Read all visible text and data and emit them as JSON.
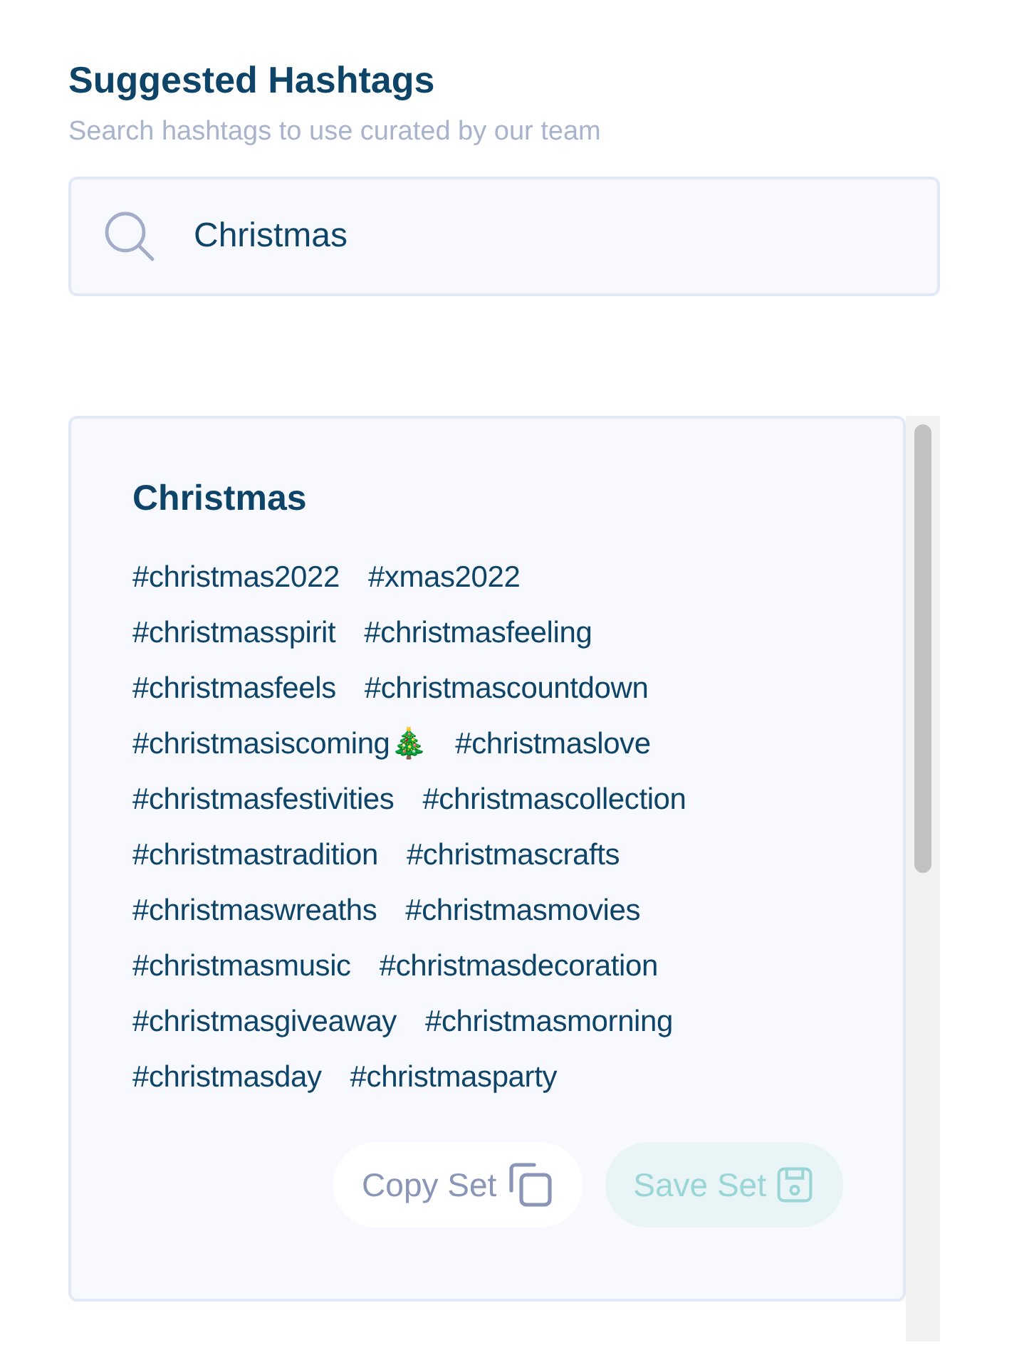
{
  "header": {
    "title": "Suggested Hashtags",
    "subtitle": "Search hashtags to use curated by our team"
  },
  "search": {
    "value": "Christmas"
  },
  "card": {
    "title": "Christmas",
    "tag_rows": [
      [
        "#christmas2022",
        "#xmas2022"
      ],
      [
        "#christmasspirit",
        "#christmasfeeling"
      ],
      [
        "#christmasfeels",
        "#christmascountdown"
      ],
      [
        "#christmasiscoming🎄",
        "#christmaslove"
      ],
      [
        "#christmasfestivities",
        "#christmascollection"
      ],
      [
        "#christmastradition",
        "#christmascrafts"
      ],
      [
        "#christmaswreaths",
        "#christmasmovies"
      ],
      [
        "#christmasmusic",
        "#christmasdecoration"
      ],
      [
        "#christmasgiveaway",
        "#christmasmorning"
      ],
      [
        "#christmasday",
        "#christmasparty"
      ]
    ],
    "buttons": [
      {
        "label": "Copy Set",
        "kind": "copy",
        "disabled": false
      },
      {
        "label": "Save Set",
        "kind": "save",
        "disabled": true
      }
    ]
  }
}
